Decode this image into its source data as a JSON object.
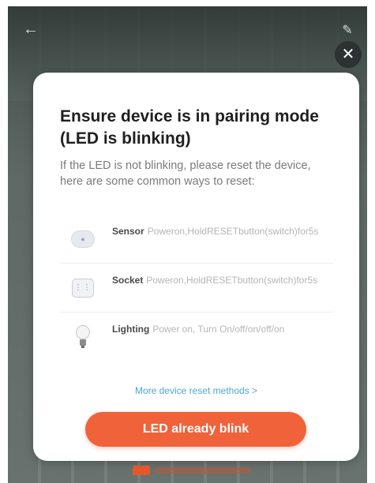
{
  "header": {
    "back_icon": "back-arrow-icon",
    "edit_icon": "pencil-icon",
    "close_icon": "close-icon",
    "close_glyph": "✕"
  },
  "dialog": {
    "title": "Ensure device is in pairing mode (LED is blinking)",
    "subtitle": "If the LED is not blinking, please reset the device, here are some common ways to reset:",
    "methods": [
      {
        "name": "Sensor",
        "description": "Poweron,HoldRESETbutton(switch)for5s",
        "icon": "sensor-icon"
      },
      {
        "name": "Socket",
        "description": "Poweron,HoldRESETbutton(switch)for5s",
        "icon": "socket-icon"
      },
      {
        "name": "Lighting",
        "description": "Power on, Turn On/off/on/off/on",
        "icon": "bulb-icon"
      }
    ],
    "more_link": "More device reset methods >",
    "primary_button": "LED already blink"
  },
  "colors": {
    "accent": "#f0623a",
    "link": "#4aa8d8",
    "overlay": "#6f7a76"
  }
}
